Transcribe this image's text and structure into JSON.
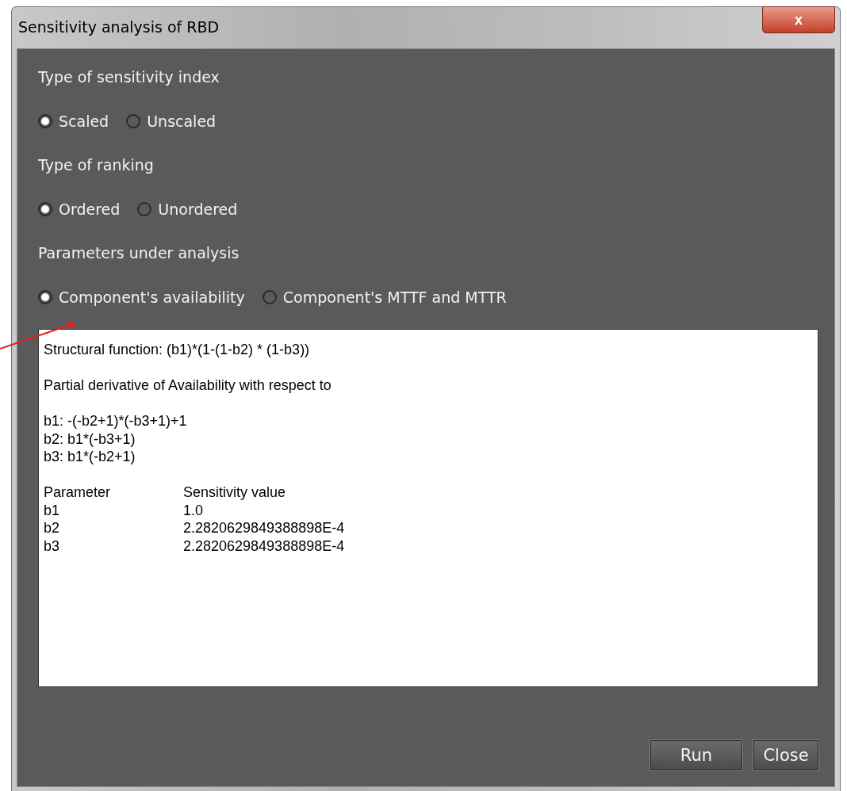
{
  "window": {
    "title": "Sensitivity analysis of RBD",
    "close": "x"
  },
  "groups": [
    {
      "label": "Type of sensitivity index",
      "options": [
        {
          "label": "Scaled",
          "selected": true
        },
        {
          "label": "Unscaled",
          "selected": false
        }
      ]
    },
    {
      "label": "Type of ranking",
      "options": [
        {
          "label": "Ordered",
          "selected": true
        },
        {
          "label": "Unordered",
          "selected": false
        }
      ]
    },
    {
      "label": "Parameters under analysis",
      "options": [
        {
          "label": "Component's availability",
          "selected": true
        },
        {
          "label": "Component's MTTF and MTTR",
          "selected": false
        }
      ]
    }
  ],
  "output": {
    "paragraphs": [
      [
        "Structural function: (b1)*(1-(1-b2) * (1-b3))"
      ],
      [
        "Partial derivative of Availability with respect to"
      ],
      [
        "b1: -(-b2+1)*(-b3+1)+1",
        "b2: b1*(-b3+1)",
        "b3: b1*(-b2+1)"
      ]
    ],
    "table": {
      "columns": [
        "Parameter",
        "Sensitivity value"
      ],
      "rows": [
        [
          "b1",
          "1.0"
        ],
        [
          "b2",
          "2.2820629849388898E-4"
        ],
        [
          "b3",
          "2.2820629849388898E-4"
        ]
      ]
    }
  },
  "buttons": [
    "Run",
    "Close"
  ]
}
